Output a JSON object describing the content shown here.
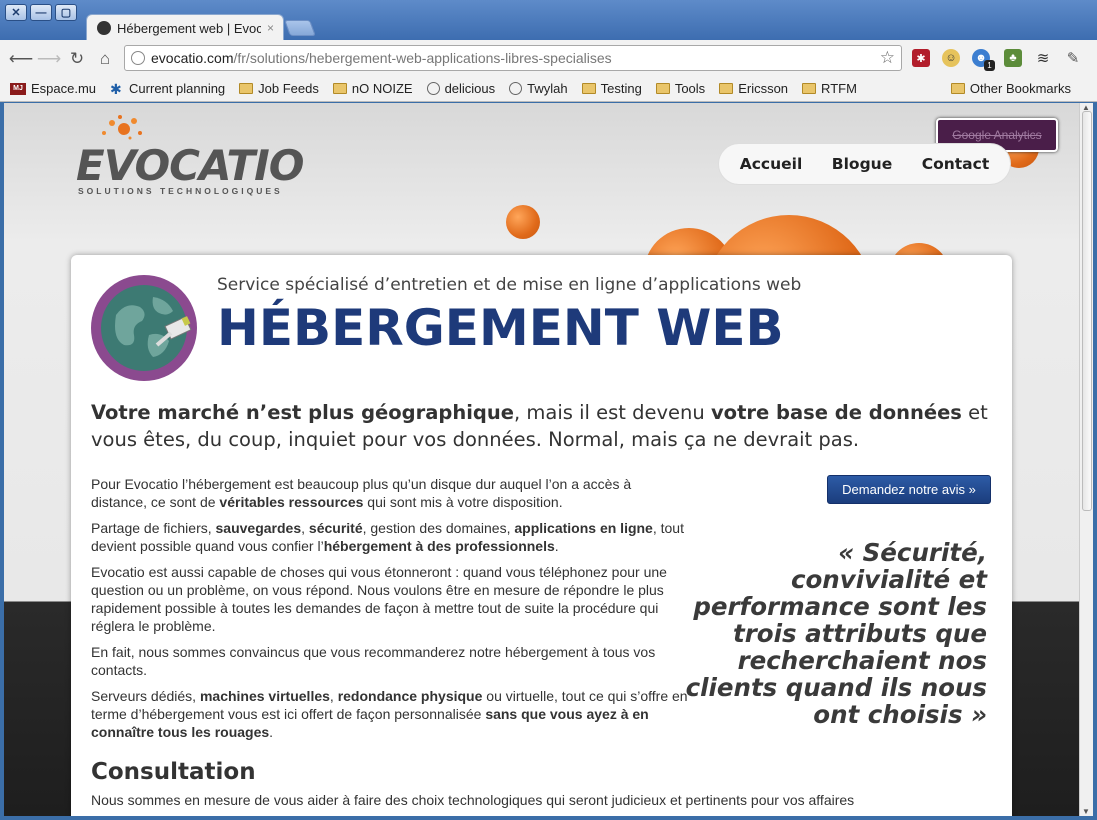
{
  "browser": {
    "tab_title": "Hébergement web | Evocatio",
    "tab_close": "×",
    "url_host": "evocatio.com",
    "url_path": "/fr/solutions/hebergement-web-applications-libres-specialises",
    "window_buttons": [
      "✕",
      "—",
      "▢"
    ],
    "bookmarks": [
      {
        "label": "Espace.mu",
        "icon": "mj-icon"
      },
      {
        "label": "Current planning",
        "icon": "person-icon"
      },
      {
        "label": "Job Feeds",
        "icon": "folder-icon"
      },
      {
        "label": "nO NOIZE",
        "icon": "folder-icon"
      },
      {
        "label": "delicious",
        "icon": "globe-icon"
      },
      {
        "label": "Twylah",
        "icon": "globe-icon"
      },
      {
        "label": "Testing",
        "icon": "folder-icon"
      },
      {
        "label": "Tools",
        "icon": "folder-icon"
      },
      {
        "label": "Ericsson",
        "icon": "folder-icon"
      },
      {
        "label": "RTFM",
        "icon": "folder-icon"
      }
    ],
    "other_bookmarks": "Other Bookmarks",
    "ext_badge": "1"
  },
  "site": {
    "logo": "EVOCATIO",
    "logo_tagline": "SOLUTIONS TECHNOLOGIQUES",
    "ga_button": "Google Analytics",
    "nav": [
      "Accueil",
      "Blogue",
      "Contact"
    ]
  },
  "content": {
    "subtitle": "Service spécialisé d’entretien et de mise en ligne d’applications web",
    "title": "HÉBERGEMENT WEB",
    "lead_b1": "Votre marché n’est plus géographique",
    "lead_t1": ", mais il est devenu ",
    "lead_b2": "votre base de données",
    "lead_t2": " et vous êtes, du coup, inquiet pour vos données. Normal, mais ça ne devrait pas.",
    "p1_t1": "Pour Evocatio l’hébergement est beaucoup plus qu’un disque dur auquel l’on a accès à distance, ce sont de ",
    "p1_b1": "véritables ressources",
    "p1_t2": " qui sont mis à votre disposition.",
    "p2_t1": "Partage de fichiers, ",
    "p2_b1": "sauvegardes",
    "p2_t2": ", ",
    "p2_b2": "sécurité",
    "p2_t3": ", gestion des domaines, ",
    "p2_b3": "applications en ligne",
    "p2_t4": ", tout devient possible quand vous confier l’",
    "p2_b4": "hébergement à des professionnels",
    "p2_t5": ".",
    "p3": "Evocatio est aussi capable de choses qui vous étonneront : quand vous téléphonez pour une question ou un problème, on vous répond. Nous voulons être en mesure de répondre le plus rapidement possible à toutes les demandes de façon à mettre tout de suite la procédure qui réglera le problème.",
    "p4": "En fait, nous sommes convaincus que vous recommanderez notre hébergement à tous vos contacts.",
    "p5_t1": "Serveurs dédiés, ",
    "p5_b1": "machines virtuelles",
    "p5_t2": ", ",
    "p5_b2": "redondance physique",
    "p5_t3": " ou virtuelle, tout ce qui s’offre en terme d’hébergement vous est ici offert de façon personnalisée ",
    "p5_b3": "sans que vous ayez à en connaître tous les rouages",
    "p5_t4": ".",
    "cta": "Demandez notre avis »",
    "quote": "« Sécurité, convivialité et performance sont les trois attributs que recherchaient nos clients quand ils nous ont choisis »",
    "section_title": "Consultation",
    "section_text": "Nous sommes en mesure de vous aider à faire des choix technologiques qui seront judicieux et pertinents pour vos affaires"
  },
  "colors": {
    "brand_orange": "#e06a1a",
    "title_blue": "#1e3a7a",
    "cta_blue": "#1b3d7d",
    "ga_purple": "#4a1e49"
  }
}
